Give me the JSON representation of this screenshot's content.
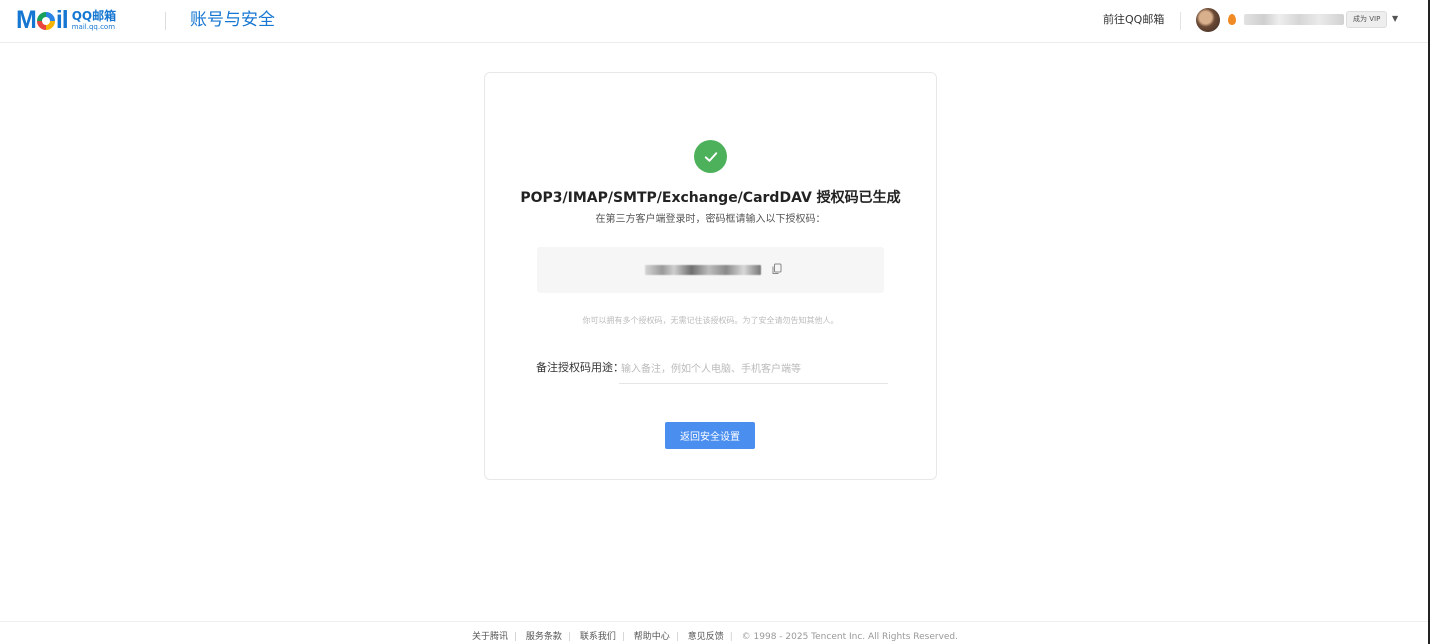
{
  "header": {
    "logo_mail": "Mail",
    "logo_qq": "QQ邮箱",
    "logo_domain": "mail.qq.com",
    "title": "账号与安全",
    "goto_label": "前往QQ邮箱",
    "vip_label": "成为 VIP",
    "icons": [
      "mail-logo-icon",
      "avatar",
      "fire-icon",
      "chevron-down-icon"
    ]
  },
  "card": {
    "status_icon": "check-circle-icon",
    "title": "POP3/IMAP/SMTP/Exchange/CardDAV 授权码已生成",
    "subtitle": "在第三方客户端登录时，密码框请输入以下授权码：",
    "copy_icon": "copy-icon",
    "hint": "你可以拥有多个授权码，无需记住该授权码。为了安全请勿告知其他人。",
    "note_label": "备注授权码用途：",
    "note_placeholder": "输入备注，例如个人电脑、手机客户端等",
    "note_value": "",
    "button_label": "返回安全设置",
    "accent_color": "#4a8ef0",
    "success_color": "#4cb15a"
  },
  "footer": {
    "links": [
      "关于腾讯",
      "服务条款",
      "联系我们",
      "帮助中心",
      "意见反馈"
    ],
    "copyright": "© 1998 - 2025 Tencent Inc. All Rights Reserved."
  }
}
